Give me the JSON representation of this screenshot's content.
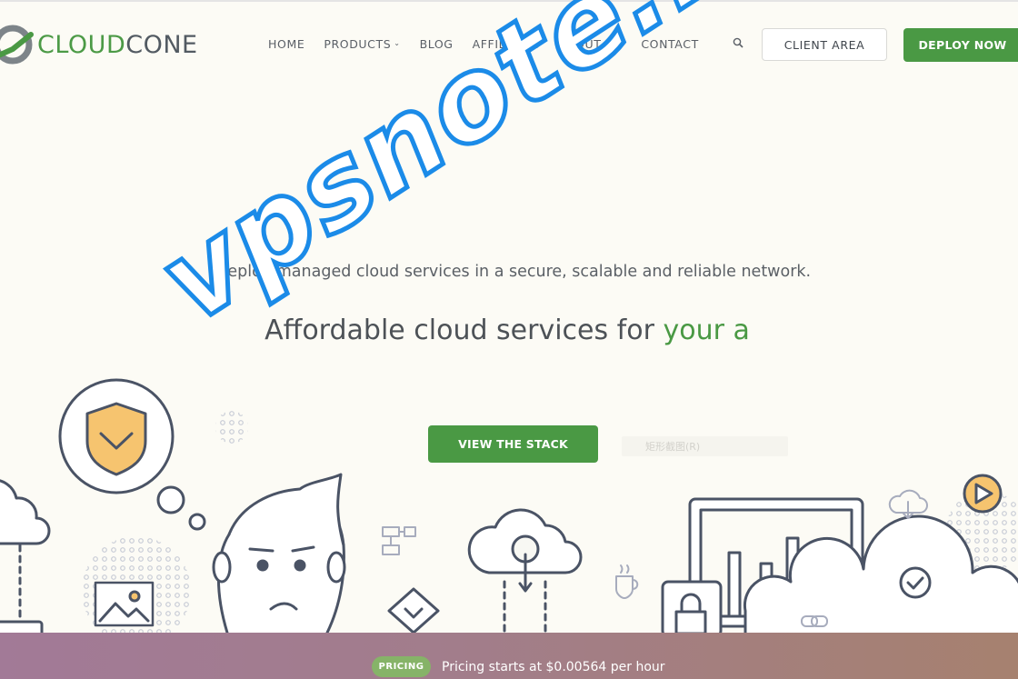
{
  "header": {
    "logo_text_cloud": "CLOUD",
    "logo_text_cone": "CONE",
    "nav": [
      {
        "label": "HOME"
      },
      {
        "label": "PRODUCTS"
      },
      {
        "label": "BLOG"
      },
      {
        "label": "AFFILIATES"
      },
      {
        "label": "ABOUT US"
      },
      {
        "label": "CONTACT"
      }
    ],
    "client_area_label": "CLIENT AREA",
    "deploy_label": "DEPLOY NOW"
  },
  "hero": {
    "subtitle": "Deploy managed cloud services in a secure, scalable and reliable network.",
    "title_main": "Affordable cloud services for ",
    "title_accent": "your a",
    "cta_label": "VIEW THE STACK",
    "ghost_text": "矩形截图(R)"
  },
  "watermark": "vpsnote.net",
  "pricing": {
    "badge": "PRICING",
    "text": "Pricing starts at $0.00564 per hour"
  },
  "icons": [
    "logo-icon",
    "search-icon",
    "chevron-down-icon",
    "shield-icon",
    "cloud-icon",
    "image-icon",
    "diamond-icon",
    "flowchart-icon",
    "cloud-upload-icon",
    "coffee-icon",
    "bar-chart-icon",
    "lock-icon",
    "check-icon",
    "play-icon",
    "cloud-download-icon",
    "link-icon"
  ],
  "colors": {
    "brand_green": "#4a9944",
    "background": "#fcfbf5",
    "watermark_blue": "#1b8be8",
    "pricing_badge": "#86b368",
    "shield_fill": "#f6c46f"
  }
}
